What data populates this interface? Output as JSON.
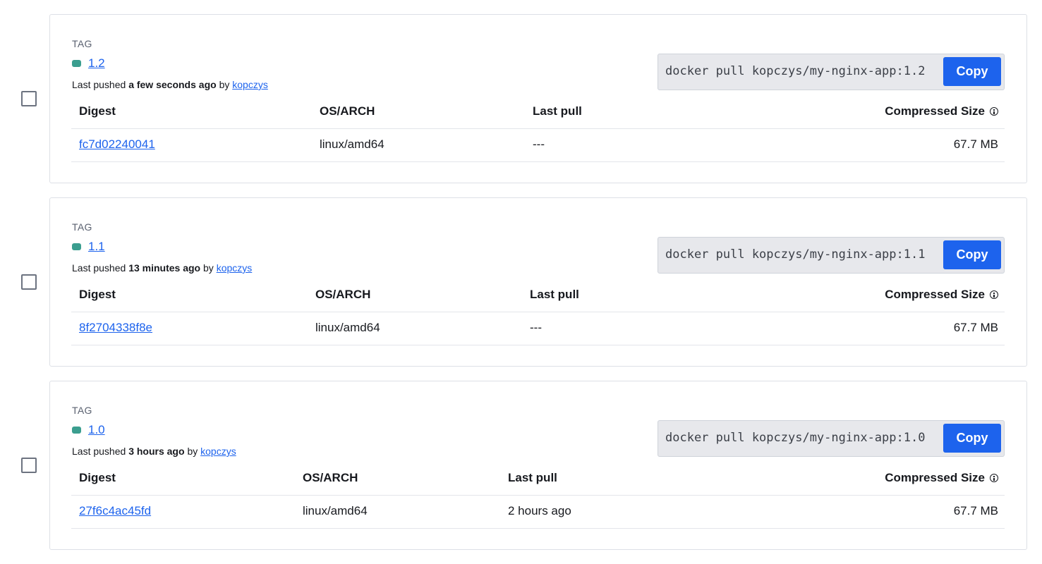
{
  "tags": [
    {
      "section_label": "TAG",
      "name": "1.2",
      "pushed_prefix": "Last pushed",
      "pushed_time": "a few seconds ago",
      "pushed_by_prefix": "by",
      "pushed_by": "kopczys",
      "pull_command": "docker pull kopczys/my-nginx-app:1.2",
      "copy_label": "Copy",
      "columns": {
        "digest": "Digest",
        "os_arch": "OS/ARCH",
        "last_pull": "Last pull",
        "size": "Compressed Size"
      },
      "digest": "fc7d02240041",
      "os_arch": "linux/amd64",
      "last_pull": "---",
      "size": "67.7 MB"
    },
    {
      "section_label": "TAG",
      "name": "1.1",
      "pushed_prefix": "Last pushed",
      "pushed_time": "13 minutes ago",
      "pushed_by_prefix": "by",
      "pushed_by": "kopczys",
      "pull_command": "docker pull kopczys/my-nginx-app:1.1",
      "copy_label": "Copy",
      "columns": {
        "digest": "Digest",
        "os_arch": "OS/ARCH",
        "last_pull": "Last pull",
        "size": "Compressed Size"
      },
      "digest": "8f2704338f8e",
      "os_arch": "linux/amd64",
      "last_pull": "---",
      "size": "67.7 MB"
    },
    {
      "section_label": "TAG",
      "name": "1.0",
      "pushed_prefix": "Last pushed",
      "pushed_time": "3 hours ago",
      "pushed_by_prefix": "by",
      "pushed_by": "kopczys",
      "pull_command": "docker pull kopczys/my-nginx-app:1.0",
      "copy_label": "Copy",
      "columns": {
        "digest": "Digest",
        "os_arch": "OS/ARCH",
        "last_pull": "Last pull",
        "size": "Compressed Size"
      },
      "digest": "27f6c4ac45fd",
      "os_arch": "linux/amd64",
      "last_pull": "2 hours ago",
      "size": "67.7 MB"
    }
  ],
  "colors": {
    "accent": "#1d63ed",
    "status_dot": "#3b9e8f",
    "card_border": "#dde0e6",
    "pull_box_bg": "#e7e8ec"
  },
  "icons": {
    "status": "status-dot-icon",
    "info": "info-icon",
    "checkbox": "checkbox-icon"
  }
}
